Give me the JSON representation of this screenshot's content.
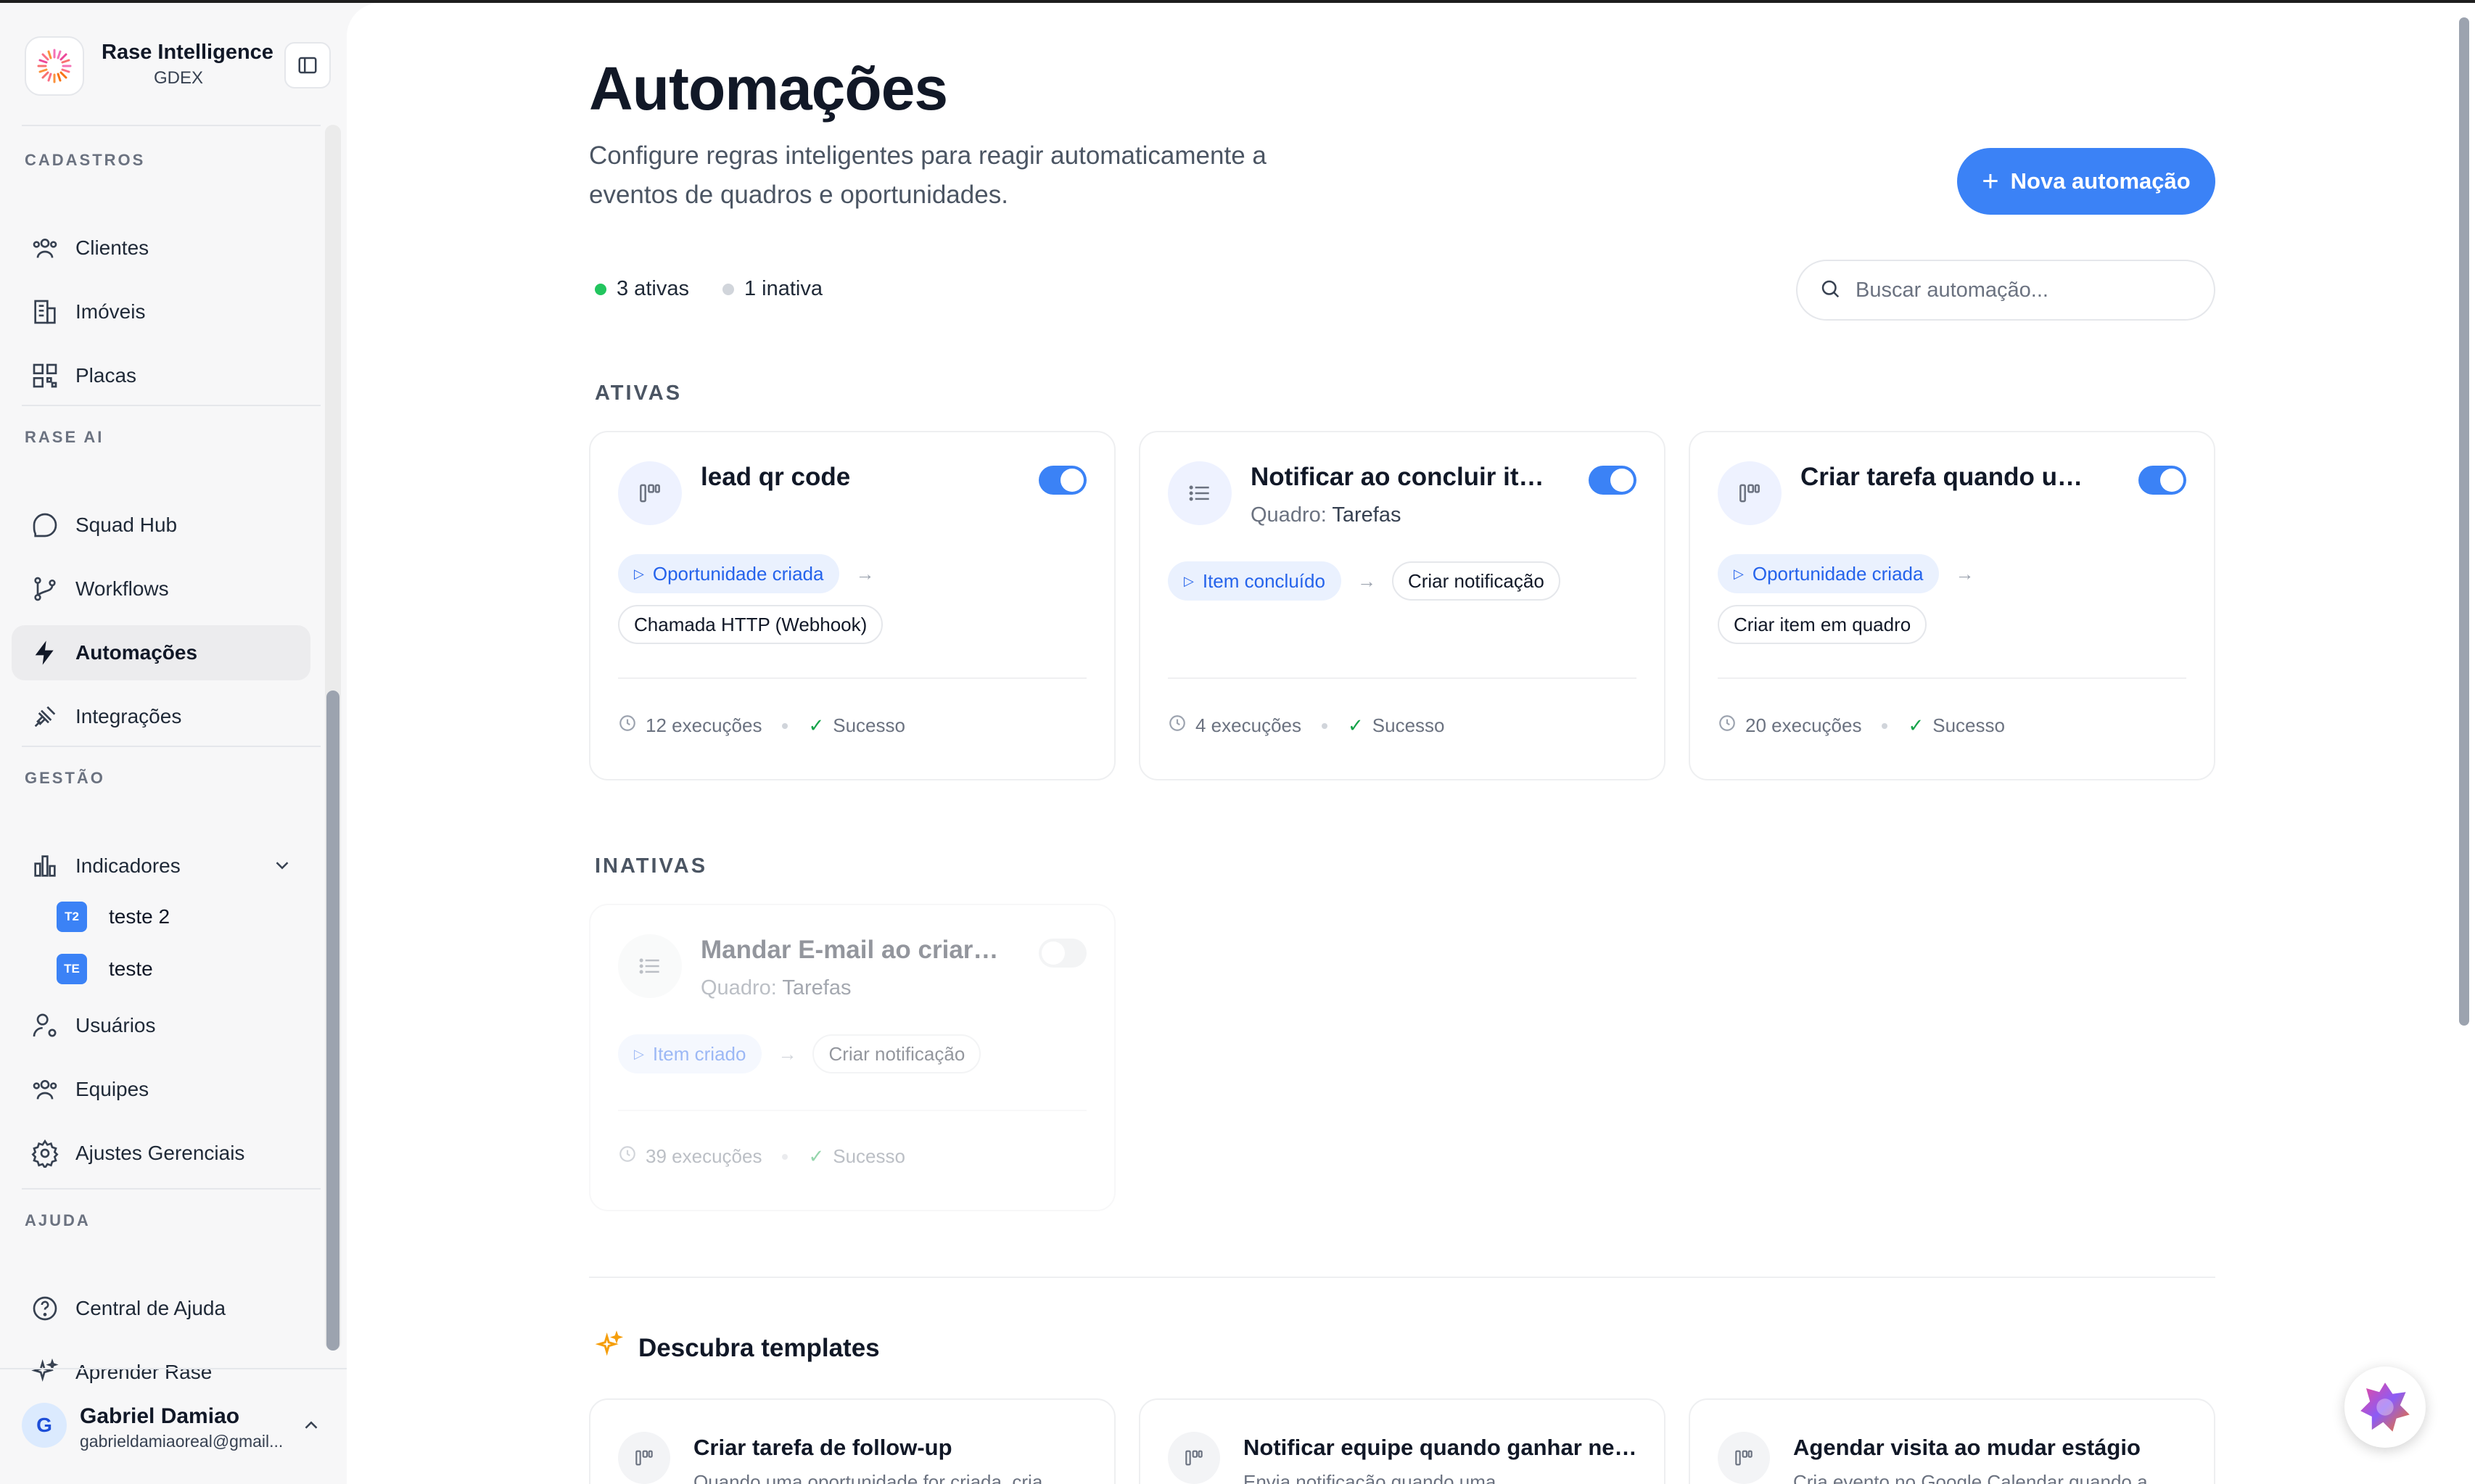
{
  "brand": {
    "name": "Rase Intelligence",
    "org": "GDEX"
  },
  "sidebar": {
    "sections": {
      "cadastros": "CADASTROS",
      "rase_ai": "RASE AI",
      "gestao": "GESTÃO",
      "ajuda": "AJUDA"
    },
    "items": {
      "clientes": "Clientes",
      "imoveis": "Imóveis",
      "placas": "Placas",
      "squad_hub": "Squad Hub",
      "workflows": "Workflows",
      "automacoes": "Automações",
      "integracoes": "Integrações",
      "indicadores": "Indicadores",
      "usuarios": "Usuários",
      "equipes": "Equipes",
      "ajustes": "Ajustes Gerenciais",
      "central_ajuda": "Central de Ajuda",
      "aprender": "Aprender Rase"
    },
    "indicadores_sub": [
      {
        "badge": "T2",
        "label": "teste 2"
      },
      {
        "badge": "TE",
        "label": "teste"
      }
    ]
  },
  "user": {
    "initial": "G",
    "name": "Gabriel Damiao",
    "email": "gabrieldamiaoreal@gmail..."
  },
  "page": {
    "title": "Automações",
    "subtitle": "Configure regras inteligentes para reagir automaticamente a eventos de quadros e oportunidades.",
    "new_button": "Nova automação",
    "active_count": "3 ativas",
    "inactive_count": "1 inativa",
    "search_placeholder": "Buscar automação...",
    "active_label": "ATIVAS",
    "inactive_label": "INATIVAS",
    "templates_label": "Descubra templates"
  },
  "automations_active": [
    {
      "title": "lead qr code",
      "board_prefix": "",
      "board": "",
      "trigger": "Oportunidade criada",
      "action": "Chamada HTTP (Webhook)",
      "runs": "12 execuções",
      "status": "Sucesso",
      "enabled": true
    },
    {
      "title": "Notificar ao concluir item",
      "board_prefix": "Quadro:",
      "board": "Tarefas",
      "trigger": "Item concluído",
      "action": "Criar notificação",
      "runs": "4 execuções",
      "status": "Sucesso",
      "enabled": true
    },
    {
      "title": "Criar tarefa quando um l...",
      "board_prefix": "",
      "board": "",
      "trigger": "Oportunidade criada",
      "action": "Criar item em quadro",
      "runs": "20 execuções",
      "status": "Sucesso",
      "enabled": true
    }
  ],
  "automations_inactive": [
    {
      "title": "Mandar E-mail ao criar u...",
      "board_prefix": "Quadro:",
      "board": "Tarefas",
      "trigger": "Item criado",
      "action": "Criar notificação",
      "runs": "39 execuções",
      "status": "Sucesso",
      "enabled": false
    }
  ],
  "templates": [
    {
      "title": "Criar tarefa de follow-up",
      "desc": "Quando uma oportunidade for criada, cria"
    },
    {
      "title": "Notificar equipe quando ganhar neg...",
      "desc": "Envia notificação quando uma"
    },
    {
      "title": "Agendar visita ao mudar estágio",
      "desc": "Cria evento no Google Calendar quando a"
    }
  ],
  "colors": {
    "accent": "#3b82f6",
    "active_dot": "#22c55e",
    "inactive_dot": "#d1d5db",
    "success": "#16a34a"
  }
}
